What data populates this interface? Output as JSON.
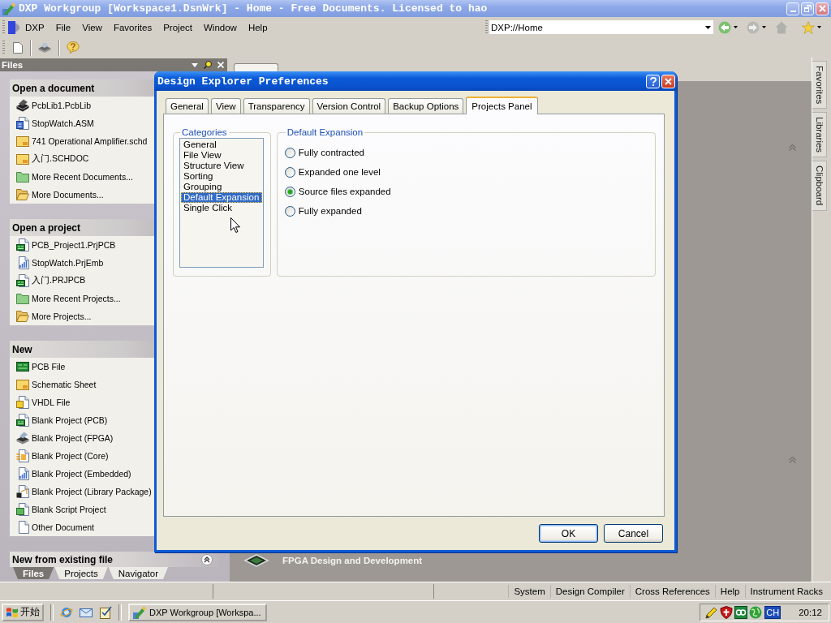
{
  "window": {
    "title": "DXP Workgroup [Workspace1.DsnWrk] - Home - Free Documents. Licensed to hao"
  },
  "menu": {
    "items": [
      "DXP",
      "File",
      "View",
      "Favorites",
      "Project",
      "Window",
      "Help"
    ]
  },
  "address_bar": {
    "value": "DXP://Home"
  },
  "files_panel": {
    "title": "Files",
    "sections": [
      {
        "title": "Open a document",
        "items": [
          {
            "label": "PcbLib1.PcbLib",
            "kind": "pcblib"
          },
          {
            "label": "StopWatch.ASM",
            "kind": "asm"
          },
          {
            "label": "741 Operational Amplifier.schd",
            "kind": "schematic"
          },
          {
            "label": "入门.SCHDOC",
            "kind": "schematic"
          },
          {
            "label": "More Recent Documents...",
            "kind": "folder"
          },
          {
            "label": "More Documents...",
            "kind": "open-folder"
          }
        ]
      },
      {
        "title": "Open a project",
        "items": [
          {
            "label": "PCB_Project1.PrjPCB",
            "kind": "pcb-project"
          },
          {
            "label": "StopWatch.PrjEmb",
            "kind": "embedded-project"
          },
          {
            "label": "入门.PRJPCB",
            "kind": "pcb-project"
          },
          {
            "label": "More Recent Projects...",
            "kind": "folder"
          },
          {
            "label": "More Projects...",
            "kind": "open-folder"
          }
        ]
      },
      {
        "title": "New",
        "items": [
          {
            "label": "PCB File",
            "kind": "pcb"
          },
          {
            "label": "Schematic Sheet",
            "kind": "schematic"
          },
          {
            "label": "VHDL File",
            "kind": "vhdl"
          },
          {
            "label": "Blank Project (PCB)",
            "kind": "pcb-project"
          },
          {
            "label": "Blank Project (FPGA)",
            "kind": "fpga"
          },
          {
            "label": "Blank Project (Core)",
            "kind": "core"
          },
          {
            "label": "Blank Project (Embedded)",
            "kind": "embedded-project"
          },
          {
            "label": "Blank Project (Library Package)",
            "kind": "library-package"
          },
          {
            "label": "Blank Script Project",
            "kind": "script"
          },
          {
            "label": "Other Document",
            "kind": "document"
          }
        ]
      }
    ],
    "footer_section": {
      "title": "New from existing file"
    },
    "tabs": [
      {
        "label": "Files",
        "selected": true
      },
      {
        "label": "Projects",
        "selected": false
      },
      {
        "label": "Navigator",
        "selected": false
      }
    ]
  },
  "home_page": {
    "feature": "FPGA Design and Development"
  },
  "side_tabs": [
    {
      "label": "Favorites"
    },
    {
      "label": "Libraries"
    },
    {
      "label": "Clipboard"
    }
  ],
  "dialog": {
    "title": "Design Explorer Preferences",
    "tabs": [
      {
        "label": "General",
        "selected": false
      },
      {
        "label": "View",
        "selected": false
      },
      {
        "label": "Transparency",
        "selected": false
      },
      {
        "label": "Version Control",
        "selected": false
      },
      {
        "label": "Backup Options",
        "selected": false
      },
      {
        "label": "Projects Panel",
        "selected": true
      }
    ],
    "categories": {
      "title": "Categories",
      "items": [
        {
          "label": "General",
          "selected": false
        },
        {
          "label": "File View",
          "selected": false
        },
        {
          "label": "Structure View",
          "selected": false
        },
        {
          "label": "Sorting",
          "selected": false
        },
        {
          "label": "Grouping",
          "selected": false
        },
        {
          "label": "Default Expansion",
          "selected": true
        },
        {
          "label": "Single Click",
          "selected": false
        }
      ]
    },
    "expansion": {
      "title": "Default Expansion",
      "options": [
        {
          "label": "Fully contracted",
          "selected": false
        },
        {
          "label": "Expanded one level",
          "selected": false
        },
        {
          "label": "Source files expanded",
          "selected": true
        },
        {
          "label": "Fully expanded",
          "selected": false
        }
      ]
    },
    "buttons": [
      {
        "label": "OK",
        "default": true
      },
      {
        "label": "Cancel",
        "default": false
      }
    ]
  },
  "status_bar": {
    "buttons": [
      "System",
      "Design Compiler",
      "Cross References",
      "Help",
      "Instrument Racks"
    ]
  },
  "taskbar": {
    "start": "开始",
    "tasks": [
      {
        "label": "DXP Workgroup [Workspa..."
      }
    ],
    "language": "CH",
    "time": "20:12"
  }
}
